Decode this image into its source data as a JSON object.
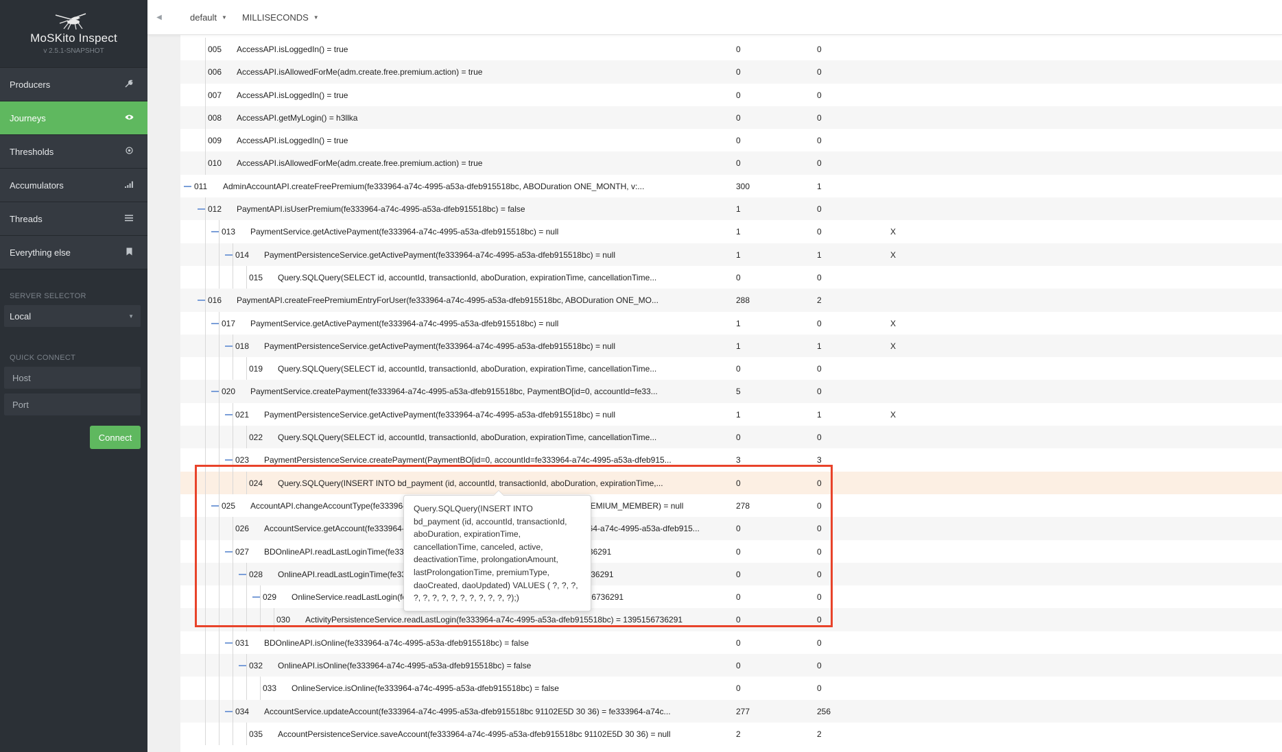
{
  "app": {
    "title": "MoSKito Inspect",
    "version": "v 2.5.1-SNAPSHOT"
  },
  "sidebar": {
    "items": [
      {
        "label": "Producers",
        "icon": "wrench-icon"
      },
      {
        "label": "Journeys",
        "icon": "eye-icon",
        "active": true
      },
      {
        "label": "Thresholds",
        "icon": "target-icon"
      },
      {
        "label": "Accumulators",
        "icon": "bar-chart-icon"
      },
      {
        "label": "Threads",
        "icon": "list-icon"
      },
      {
        "label": "Everything else",
        "icon": "bookmark-icon"
      }
    ],
    "server_selector": {
      "label": "SERVER SELECTOR",
      "value": "Local"
    },
    "quick_connect": {
      "label": "QUICK CONNECT",
      "host_placeholder": "Host",
      "port_placeholder": "Port",
      "connect_label": "Connect"
    }
  },
  "topbar": {
    "interval": "default",
    "unit": "MILLISECONDS"
  },
  "colors": {
    "accent_green": "#5fb85f",
    "sidebar_bg": "#2b3036",
    "highlight_row": "#fcefe3",
    "red_frame": "#e8432a",
    "expander_blue": "#7a9ed8"
  },
  "rows": [
    {
      "n": "005",
      "call": "AccessAPI.isLoggedIn() = true",
      "depth": 2,
      "parent": false,
      "c1": "0",
      "c2": "0",
      "c3": ""
    },
    {
      "n": "006",
      "call": "AccessAPI.isAllowedForMe(adm.create.free.premium.action) = true",
      "depth": 2,
      "parent": false,
      "c1": "0",
      "c2": "0",
      "c3": ""
    },
    {
      "n": "007",
      "call": "AccessAPI.isLoggedIn() = true",
      "depth": 2,
      "parent": false,
      "c1": "0",
      "c2": "0",
      "c3": ""
    },
    {
      "n": "008",
      "call": "AccessAPI.getMyLogin() = h3llka",
      "depth": 2,
      "parent": false,
      "c1": "0",
      "c2": "0",
      "c3": ""
    },
    {
      "n": "009",
      "call": "AccessAPI.isLoggedIn() = true",
      "depth": 2,
      "parent": false,
      "c1": "0",
      "c2": "0",
      "c3": ""
    },
    {
      "n": "010",
      "call": "AccessAPI.isAllowedForMe(adm.create.free.premium.action) = true",
      "depth": 2,
      "parent": false,
      "c1": "0",
      "c2": "0",
      "c3": ""
    },
    {
      "n": "011",
      "call": "AdminAccountAPI.createFreePremium(fe333964-a74c-4995-a53a-dfeb915518bc, ABODuration ONE_MONTH, v:...",
      "depth": 1,
      "parent": true,
      "c1": "300",
      "c2": "1",
      "c3": ""
    },
    {
      "n": "012",
      "call": "PaymentAPI.isUserPremium(fe333964-a74c-4995-a53a-dfeb915518bc) = false",
      "depth": 2,
      "parent": true,
      "c1": "1",
      "c2": "0",
      "c3": ""
    },
    {
      "n": "013",
      "call": "PaymentService.getActivePayment(fe333964-a74c-4995-a53a-dfeb915518bc) = null",
      "depth": 3,
      "parent": true,
      "c1": "1",
      "c2": "0",
      "c3": "X"
    },
    {
      "n": "014",
      "call": "PaymentPersistenceService.getActivePayment(fe333964-a74c-4995-a53a-dfeb915518bc) = null",
      "depth": 4,
      "parent": true,
      "c1": "1",
      "c2": "1",
      "c3": "X"
    },
    {
      "n": "015",
      "call": "Query.SQLQuery(SELECT id, accountId, transactionId, aboDuration, expirationTime, cancellationTime...",
      "depth": 5,
      "parent": false,
      "c1": "0",
      "c2": "0",
      "c3": ""
    },
    {
      "n": "016",
      "call": "PaymentAPI.createFreePremiumEntryForUser(fe333964-a74c-4995-a53a-dfeb915518bc, ABODuration ONE_MO...",
      "depth": 2,
      "parent": true,
      "c1": "288",
      "c2": "2",
      "c3": ""
    },
    {
      "n": "017",
      "call": "PaymentService.getActivePayment(fe333964-a74c-4995-a53a-dfeb915518bc) = null",
      "depth": 3,
      "parent": true,
      "c1": "1",
      "c2": "0",
      "c3": "X"
    },
    {
      "n": "018",
      "call": "PaymentPersistenceService.getActivePayment(fe333964-a74c-4995-a53a-dfeb915518bc) = null",
      "depth": 4,
      "parent": true,
      "c1": "1",
      "c2": "1",
      "c3": "X"
    },
    {
      "n": "019",
      "call": "Query.SQLQuery(SELECT id, accountId, transactionId, aboDuration, expirationTime, cancellationTime...",
      "depth": 5,
      "parent": false,
      "c1": "0",
      "c2": "0",
      "c3": ""
    },
    {
      "n": "020",
      "call": "PaymentService.createPayment(fe333964-a74c-4995-a53a-dfeb915518bc, PaymentBO[id=0, accountId=fe33...",
      "depth": 3,
      "parent": true,
      "c1": "5",
      "c2": "0",
      "c3": ""
    },
    {
      "n": "021",
      "call": "PaymentPersistenceService.getActivePayment(fe333964-a74c-4995-a53a-dfeb915518bc) = null",
      "depth": 4,
      "parent": true,
      "c1": "1",
      "c2": "1",
      "c3": "X"
    },
    {
      "n": "022",
      "call": "Query.SQLQuery(SELECT id, accountId, transactionId, aboDuration, expirationTime, cancellationTime...",
      "depth": 5,
      "parent": false,
      "c1": "0",
      "c2": "0",
      "c3": ""
    },
    {
      "n": "023",
      "call": "PaymentPersistenceService.createPayment(PaymentBO[id=0, accountId=fe333964-a74c-4995-a53a-dfeb915...",
      "depth": 4,
      "parent": true,
      "c1": "3",
      "c2": "3",
      "c3": ""
    },
    {
      "n": "024",
      "call": "Query.SQLQuery(INSERT INTO bd_payment (id, accountId, transactionId, aboDuration, expirationTime,...",
      "depth": 5,
      "parent": false,
      "c1": "0",
      "c2": "0",
      "c3": "",
      "highlight": true
    },
    {
      "n": "025",
      "call": "AccountAPI.changeAccountType(fe333964-a74c-4995-a53a-dfeb915518bc, AccountType PREMIUM_MEMBER) = null",
      "depth": 3,
      "parent": true,
      "c1": "278",
      "c2": "0",
      "c3": ""
    },
    {
      "n": "026",
      "call": "AccountService.getAccount(fe333964-a74c-4995-a53a-dfeb915518bc) = Account fe333964-a74c-4995-a53a-dfeb915...",
      "depth": 4,
      "parent": false,
      "c1": "0",
      "c2": "0",
      "c3": ""
    },
    {
      "n": "027",
      "call": "BDOnlineAPI.readLastLoginTime(fe333964-a74c-4995-a53a-dfeb915518bc) = 1395156736291",
      "depth": 4,
      "parent": true,
      "c1": "0",
      "c2": "0",
      "c3": ""
    },
    {
      "n": "028",
      "call": "OnlineAPI.readLastLoginTime(fe333964-a74c-4995-a53a-dfeb915518bc) = 1395156736291",
      "depth": 5,
      "parent": true,
      "c1": "0",
      "c2": "0",
      "c3": ""
    },
    {
      "n": "029",
      "call": "OnlineService.readLastLogin(fe333964-a74c-4995-a53a-dfeb915518bc) = 1395156736291",
      "depth": 6,
      "parent": true,
      "c1": "0",
      "c2": "0",
      "c3": ""
    },
    {
      "n": "030",
      "call": "ActivityPersistenceService.readLastLogin(fe333964-a74c-4995-a53a-dfeb915518bc) = 1395156736291",
      "depth": 7,
      "parent": false,
      "c1": "0",
      "c2": "0",
      "c3": ""
    },
    {
      "n": "031",
      "call": "BDOnlineAPI.isOnline(fe333964-a74c-4995-a53a-dfeb915518bc) = false",
      "depth": 4,
      "parent": true,
      "c1": "0",
      "c2": "0",
      "c3": ""
    },
    {
      "n": "032",
      "call": "OnlineAPI.isOnline(fe333964-a74c-4995-a53a-dfeb915518bc) = false",
      "depth": 5,
      "parent": true,
      "c1": "0",
      "c2": "0",
      "c3": ""
    },
    {
      "n": "033",
      "call": "OnlineService.isOnline(fe333964-a74c-4995-a53a-dfeb915518bc) = false",
      "depth": 6,
      "parent": false,
      "c1": "0",
      "c2": "0",
      "c3": ""
    },
    {
      "n": "034",
      "call": "AccountService.updateAccount(fe333964-a74c-4995-a53a-dfeb915518bc 91102E5D 30 36) = fe333964-a74c...",
      "depth": 4,
      "parent": true,
      "c1": "277",
      "c2": "256",
      "c3": ""
    },
    {
      "n": "035",
      "call": "AccountPersistenceService.saveAccount(fe333964-a74c-4995-a53a-dfeb915518bc 91102E5D 30 36) = null",
      "depth": 5,
      "parent": false,
      "c1": "2",
      "c2": "2",
      "c3": ""
    }
  ],
  "tooltip": {
    "lines": [
      "Query.SQLQuery(INSERT INTO",
      "bd_payment (id, accountId, transactionId,",
      "aboDuration, expirationTime,",
      "cancellationTime, canceled, active,",
      "deactivationTime, prolongationAmount,",
      "lastProlongationTime, premiumType,",
      "daoCreated, daoUpdated) VALUES ( ?, ?, ?,",
      "?, ?, ?, ?, ?, ?, ?, ?, ?, ?, ?);)"
    ]
  }
}
